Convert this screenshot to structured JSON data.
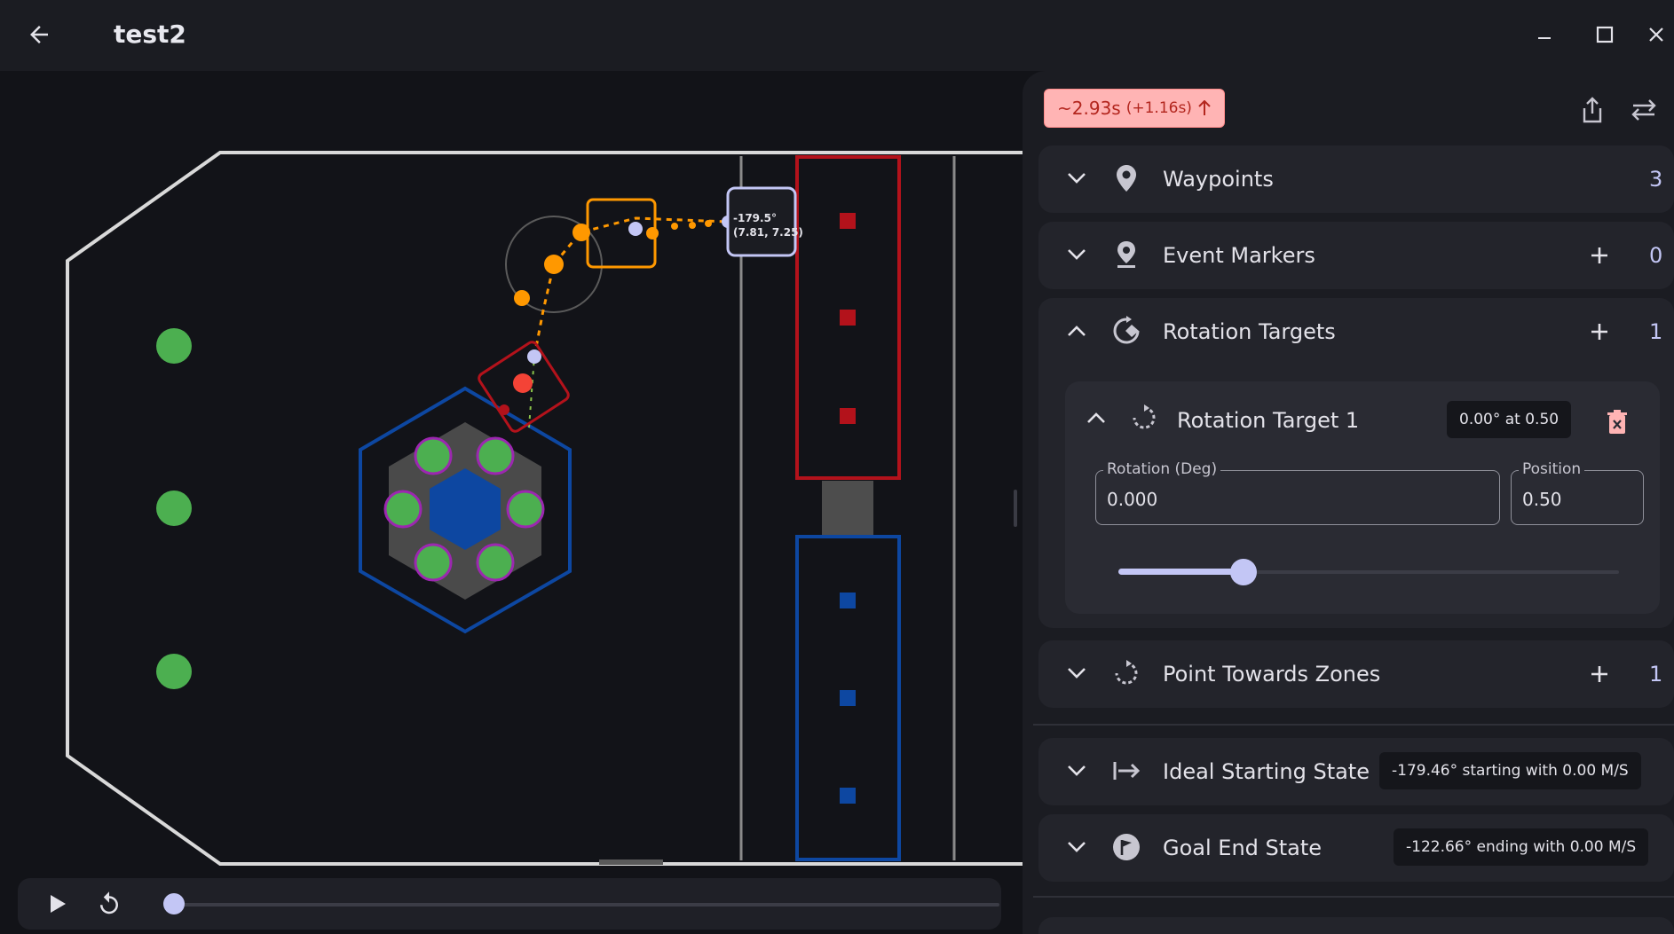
{
  "app": {
    "title": "test2"
  },
  "window_controls": [
    "minimize",
    "maximize",
    "close"
  ],
  "path_summary": {
    "time": "~2.93s",
    "delta": "(+1.16s)",
    "status_color": "#ffb4b4"
  },
  "field": {
    "robot_label": {
      "rotation": "-179.5°",
      "position": "(7.81, 7.25)"
    },
    "alliance_colors": {
      "red": "#b3121b",
      "blue": "#0d47a1"
    },
    "path_color": "#ff9800"
  },
  "playback": {
    "progress": 0.0
  },
  "sidebar": {
    "waypoints": {
      "label": "Waypoints",
      "count": "3"
    },
    "event_markers": {
      "label": "Event Markers",
      "count": "0"
    },
    "rotation_targets": {
      "label": "Rotation Targets",
      "count": "1",
      "items": [
        {
          "name": "Rotation Target 1",
          "summary": "0.00° at 0.50",
          "rotation_label": "Rotation (Deg)",
          "rotation_value": "0.000",
          "position_label": "Position",
          "position_value": "0.50",
          "slider_value": 0.5
        }
      ]
    },
    "point_towards_zones": {
      "label": "Point Towards Zones",
      "count": "1"
    },
    "ideal_starting_state": {
      "label": "Ideal Starting State",
      "summary": "-179.46° starting with 0.00 M/S"
    },
    "goal_end_state": {
      "label": "Goal End State",
      "summary": "-122.66° ending with 0.00 M/S"
    }
  },
  "accent_color": "#c3c6f5"
}
